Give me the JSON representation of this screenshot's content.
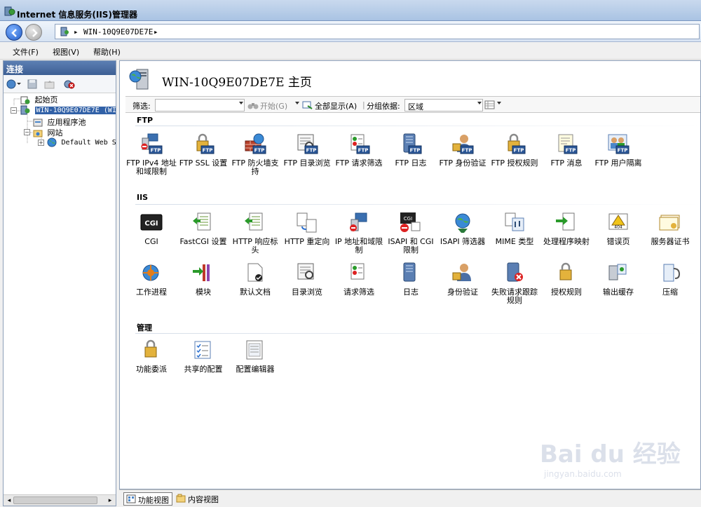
{
  "window": {
    "title": "Internet 信息服务(IIS)管理器"
  },
  "address": {
    "crumbs": [
      "WIN-10Q9E07DE7E"
    ]
  },
  "menu": [
    "文件(F)",
    "视图(V)",
    "帮助(H)"
  ],
  "connections": {
    "header": "连接",
    "tree": [
      {
        "label": "起始页"
      },
      {
        "label": "WIN-10Q9E07DE7E (WIN"
      },
      {
        "label": "应用程序池"
      },
      {
        "label": "网站"
      },
      {
        "label": "Default Web S"
      }
    ]
  },
  "page": {
    "title": "WIN-10Q9E07DE7E 主页"
  },
  "filter": {
    "label": "筛选:",
    "start": "开始(G)",
    "show_all": "全部显示(A)",
    "group_by_label": "分组依据:",
    "group_by_value": "区域"
  },
  "groups": [
    {
      "title": "FTP",
      "items": [
        {
          "label": "FTP IPv4 地址和域限制",
          "icon": "ftp-ip-restrictions-icon"
        },
        {
          "label": "FTP SSL 设置",
          "icon": "ftp-ssl-lock-icon"
        },
        {
          "label": "FTP 防火墙支持",
          "icon": "ftp-firewall-icon"
        },
        {
          "label": "FTP 目录浏览",
          "icon": "ftp-directory-browsing-icon"
        },
        {
          "label": "FTP 请求筛选",
          "icon": "ftp-request-filtering-icon"
        },
        {
          "label": "FTP 日志",
          "icon": "ftp-logging-icon"
        },
        {
          "label": "FTP 身份验证",
          "icon": "ftp-authentication-icon"
        },
        {
          "label": "FTP 授权规则",
          "icon": "ftp-authorization-icon"
        },
        {
          "label": "FTP 消息",
          "icon": "ftp-messages-icon"
        },
        {
          "label": "FTP 用户隔离",
          "icon": "ftp-user-isolation-icon"
        }
      ]
    },
    {
      "title": "IIS",
      "items": [
        {
          "label": "CGI",
          "icon": "cgi-icon"
        },
        {
          "label": "FastCGI 设置",
          "icon": "fastcgi-icon"
        },
        {
          "label": "HTTP 响应标头",
          "icon": "http-headers-icon"
        },
        {
          "label": "HTTP 重定向",
          "icon": "http-redirect-icon"
        },
        {
          "label": "IP 地址和域限制",
          "icon": "ip-restrictions-icon"
        },
        {
          "label": "ISAPI 和 CGI 限制",
          "icon": "isapi-cgi-restrictions-icon"
        },
        {
          "label": "ISAPI 筛选器",
          "icon": "isapi-filters-icon"
        },
        {
          "label": "MIME 类型",
          "icon": "mime-types-icon"
        },
        {
          "label": "处理程序映射",
          "icon": "handler-mappings-icon"
        },
        {
          "label": "错误页",
          "icon": "error-pages-icon"
        },
        {
          "label": "服务器证书",
          "icon": "server-certificates-icon"
        },
        {
          "label": "工作进程",
          "icon": "worker-processes-icon"
        },
        {
          "label": "模块",
          "icon": "modules-icon"
        },
        {
          "label": "默认文档",
          "icon": "default-document-icon"
        },
        {
          "label": "目录浏览",
          "icon": "directory-browsing-icon"
        },
        {
          "label": "请求筛选",
          "icon": "request-filtering-icon"
        },
        {
          "label": "日志",
          "icon": "logging-icon"
        },
        {
          "label": "身份验证",
          "icon": "authentication-icon"
        },
        {
          "label": "失败请求跟踪规则",
          "icon": "failed-request-tracing-icon"
        },
        {
          "label": "授权规则",
          "icon": "authorization-rules-icon"
        },
        {
          "label": "输出缓存",
          "icon": "output-caching-icon"
        },
        {
          "label": "压缩",
          "icon": "compression-icon"
        }
      ]
    },
    {
      "title": "管理",
      "items": [
        {
          "label": "功能委派",
          "icon": "feature-delegation-icon"
        },
        {
          "label": "共享的配置",
          "icon": "shared-configuration-icon"
        },
        {
          "label": "配置编辑器",
          "icon": "configuration-editor-icon"
        }
      ]
    }
  ],
  "views": {
    "features": "功能视图",
    "content": "内容视图"
  },
  "watermark": {
    "line1": "Bai du 经验",
    "line2": "jingyan.baidu.com"
  }
}
